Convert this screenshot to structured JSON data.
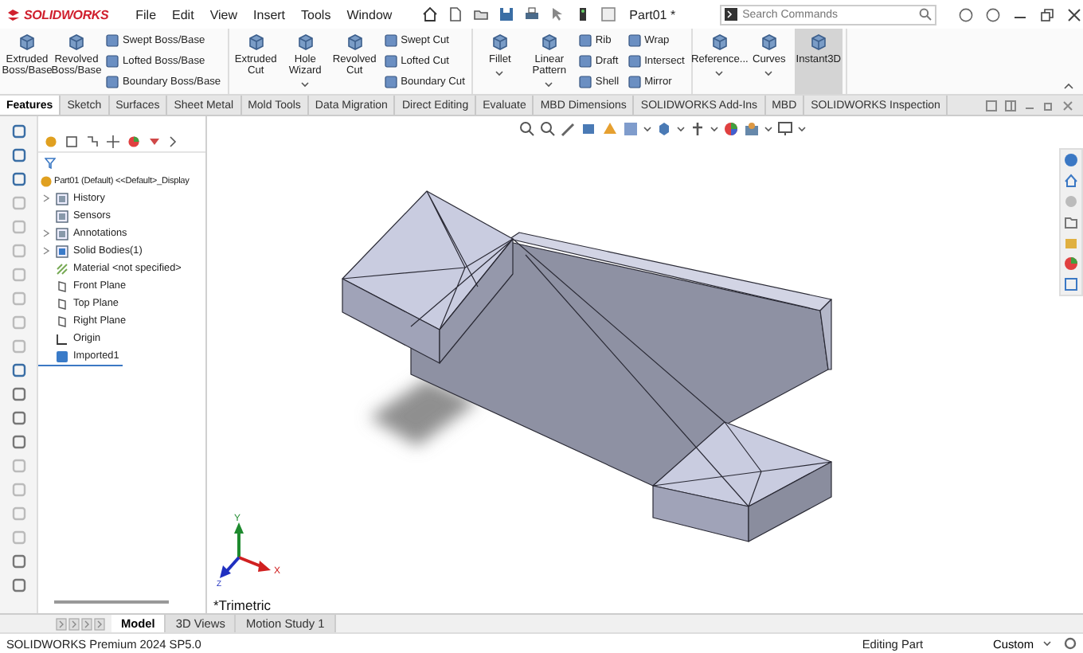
{
  "title_bar": {
    "logo": "SOLIDWORKS",
    "menu": [
      "File",
      "Edit",
      "View",
      "Insert",
      "Tools",
      "Window"
    ],
    "document_title": "Part01 *",
    "search": {
      "placeholder": "Search Commands"
    }
  },
  "ribbon": {
    "groups": [
      {
        "columns": [
          {
            "kind": "large",
            "label": "Extruded Boss/Base",
            "dropdown": false,
            "selected": false
          },
          {
            "kind": "large",
            "label": "Revolved Boss/Base",
            "dropdown": false,
            "selected": false
          },
          {
            "kind": "stack",
            "items": [
              "Swept Boss/Base",
              "Lofted Boss/Base",
              "Boundary Boss/Base"
            ]
          }
        ]
      },
      {
        "columns": [
          {
            "kind": "large",
            "label": "Extruded Cut",
            "dropdown": false,
            "selected": false
          },
          {
            "kind": "large",
            "label": "Hole Wizard",
            "dropdown": true,
            "selected": false
          },
          {
            "kind": "large",
            "label": "Revolved Cut",
            "dropdown": false,
            "selected": false
          },
          {
            "kind": "stack",
            "items": [
              "Swept Cut",
              "Lofted Cut",
              "Boundary Cut"
            ]
          }
        ]
      },
      {
        "columns": [
          {
            "kind": "large",
            "label": "Fillet",
            "dropdown": true,
            "selected": false
          },
          {
            "kind": "large",
            "label": "Linear Pattern",
            "dropdown": true,
            "selected": false
          },
          {
            "kind": "stack",
            "items": [
              "Rib",
              "Draft",
              "Shell"
            ]
          },
          {
            "kind": "stack",
            "items": [
              "Wrap",
              "Intersect",
              "Mirror"
            ]
          }
        ]
      },
      {
        "columns": [
          {
            "kind": "large",
            "label": "Reference...",
            "dropdown": true,
            "selected": false
          },
          {
            "kind": "large",
            "label": "Curves",
            "dropdown": true,
            "selected": false
          },
          {
            "kind": "large",
            "label": "Instant3D",
            "dropdown": false,
            "selected": true
          }
        ]
      }
    ]
  },
  "tabs": [
    {
      "label": "Features",
      "selected": true
    },
    {
      "label": "Sketch",
      "selected": false
    },
    {
      "label": "Surfaces",
      "selected": false
    },
    {
      "label": "Sheet Metal",
      "selected": false
    },
    {
      "label": "Mold Tools",
      "selected": false
    },
    {
      "label": "Data Migration",
      "selected": false
    },
    {
      "label": "Direct Editing",
      "selected": false
    },
    {
      "label": "Evaluate",
      "selected": false
    },
    {
      "label": "MBD Dimensions",
      "selected": false
    },
    {
      "label": "SOLIDWORKS Add-Ins",
      "selected": false
    },
    {
      "label": "MBD",
      "selected": false
    },
    {
      "label": "SOLIDWORKS Inspection",
      "selected": false
    }
  ],
  "feature_tree": {
    "root": "Part01 (Default) <<Default>_Display",
    "items": [
      {
        "label": "History",
        "kind": "folder",
        "expander": true
      },
      {
        "label": "Sensors",
        "kind": "folder",
        "expander": false
      },
      {
        "label": "Annotations",
        "kind": "folder",
        "expander": true
      },
      {
        "label": "Solid Bodies(1)",
        "kind": "bodies",
        "expander": true
      },
      {
        "label": "Material <not specified>",
        "kind": "material",
        "expander": false
      },
      {
        "label": "Front Plane",
        "kind": "plane",
        "expander": false
      },
      {
        "label": "Top Plane",
        "kind": "plane",
        "expander": false
      },
      {
        "label": "Right Plane",
        "kind": "plane",
        "expander": false
      },
      {
        "label": "Origin",
        "kind": "origin",
        "expander": false
      },
      {
        "label": "Imported1",
        "kind": "body",
        "expander": false
      }
    ]
  },
  "viewport": {
    "view_name": "*Trimetric",
    "triad": [
      "Y",
      "X",
      "Z"
    ]
  },
  "bottom_tabs": [
    {
      "label": "Model",
      "selected": true
    },
    {
      "label": "3D Views",
      "selected": false
    },
    {
      "label": "Motion Study 1",
      "selected": false
    }
  ],
  "status_bar": {
    "product": "SOLIDWORKS Premium 2024 SP5.0",
    "mode": "Editing Part",
    "units": "Custom"
  }
}
